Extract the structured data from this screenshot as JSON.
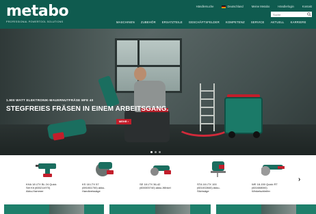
{
  "brand": {
    "logo": "metabo",
    "tagline": "PROFESSIONAL POWERTOOL SOLUTIONS"
  },
  "topbar": {
    "items": [
      "Händlersuche",
      "Deutschland",
      "Meine Metabo",
      "Händlerlogin",
      "Kontakt"
    ]
  },
  "search": {
    "placeholder": "Suche"
  },
  "nav": {
    "items": [
      "MASCHINEN",
      "ZUBEHÖR",
      "ERSATZTEILE",
      "GESCHÄFTSFELDER",
      "KOMPETENZ",
      "SERVICE",
      "AKTUELL",
      "KARRIERE"
    ]
  },
  "hero": {
    "kicker": "1.900 WATT ELEKTRONIK-MAUERNUTFRÄSE MFE 40",
    "title": "STEGFREIES FRÄSEN IN EINEM ARBEITSGANG.",
    "button_label": "MEHR ›"
  },
  "products": [
    {
      "name": "KHA 18 LTX BL 24 Quick\nSet Kit (600211970)\nAkku-Hammer"
    },
    {
      "name": "KS 18 LTX 57\n(691061700) akku-\nHandkreissäge"
    },
    {
      "name": "SE 18 LTX 36-42\n(600300740) akku-Winkel"
    },
    {
      "name": "STA 18 LTX 100\n(601002840) Akku-\nStichsäge"
    },
    {
      "name": "WE 18-150 Quick RT\n(601088000)\nWinkelschleifer"
    }
  ],
  "colors": {
    "brand_green": "#0f5b4f",
    "accent_red": "#c21e2b"
  }
}
